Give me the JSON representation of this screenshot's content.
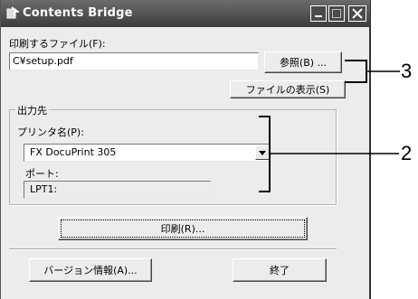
{
  "window": {
    "title": "Contents Bridge",
    "controls": {
      "minimize": "minimize-icon",
      "maximize": "maximize-icon",
      "close": "close-icon"
    }
  },
  "file": {
    "label": "印刷するファイル(F):",
    "value": "C¥setup.pdf",
    "browse_label": "参照(B) ...",
    "show_file_label": "ファイルの表示(S)"
  },
  "output": {
    "group_label": "出力先",
    "printer_label": "プリンタ名(P):",
    "printer_value": "FX DocuPrint 305",
    "port_label": "ポート:",
    "port_value": "LPT1:"
  },
  "actions": {
    "print_label": "印刷(R)...",
    "version_label": "バージョン情報(A)...",
    "exit_label": "終了"
  },
  "callouts": {
    "first": "3",
    "second": "2"
  }
}
